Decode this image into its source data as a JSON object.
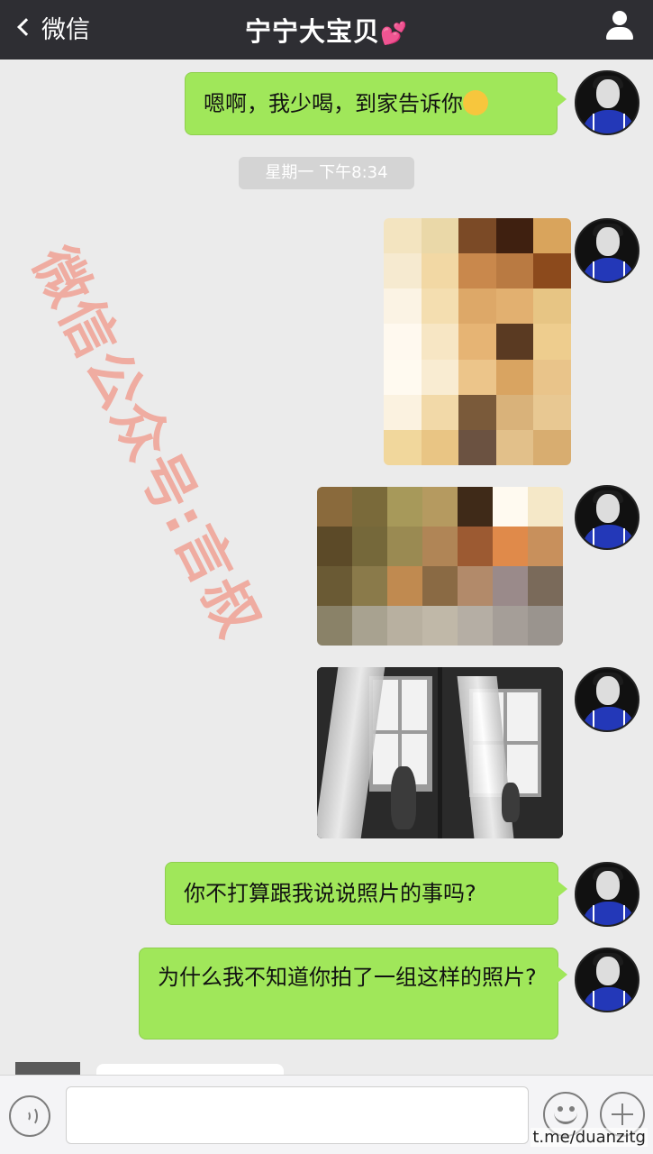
{
  "header": {
    "back_label": "微信",
    "title": "宁宁大宝贝",
    "title_emoji": "💕"
  },
  "messages": {
    "msg1": "嗯啊，我少喝，到家告诉你",
    "timestamp": "星期一 下午8:34",
    "msg2": "你不打算跟我说说照片的事吗?",
    "msg3": "为什么我不知道你拍了一组这样的照片?"
  },
  "watermark": "微信公众号:言叔",
  "credit": "t.me/duanzitg",
  "icons": {
    "back": "chevron-left-icon",
    "profile": "person-icon",
    "voice": "voice-icon",
    "emoji": "emoji-icon",
    "plus": "plus-icon"
  },
  "colors": {
    "header_bg": "#2e2e33",
    "bubble_green": "#a0e75a",
    "chat_bg": "#ebebeb"
  }
}
